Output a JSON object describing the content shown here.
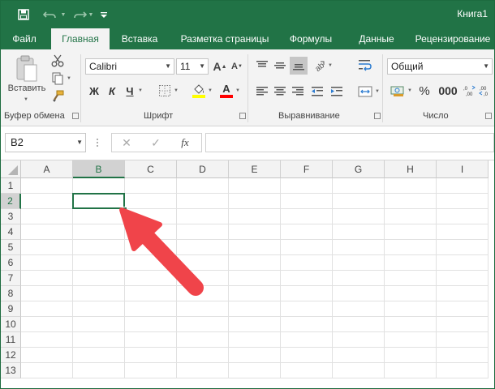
{
  "window": {
    "title": "Книга1"
  },
  "qat": {
    "save_icon": "save-icon",
    "undo_icon": "undo-icon",
    "redo_icon": "redo-icon",
    "customize_icon": "customize-qat-icon"
  },
  "tabs": [
    {
      "label": "Файл",
      "active": false
    },
    {
      "label": "Главная",
      "active": true
    },
    {
      "label": "Вставка",
      "active": false
    },
    {
      "label": "Разметка страницы",
      "active": false
    },
    {
      "label": "Формулы",
      "active": false
    },
    {
      "label": "Данные",
      "active": false
    },
    {
      "label": "Рецензирование",
      "active": false
    }
  ],
  "ribbon": {
    "clipboard": {
      "label": "Буфер обмена",
      "paste_label": "Вставить"
    },
    "font": {
      "label": "Шрифт",
      "font_name": "Calibri",
      "font_size": "11",
      "bold": "Ж",
      "italic": "К",
      "underline": "Ч",
      "fill_color": "#ffff00",
      "font_color": "#ff0000"
    },
    "alignment": {
      "label": "Выравнивание"
    },
    "number": {
      "label": "Число",
      "format": "Общий"
    }
  },
  "formula_bar": {
    "name_box": "B2",
    "cancel": "✕",
    "enter": "✓",
    "fx": "fx",
    "formula": ""
  },
  "sheet": {
    "columns": [
      "A",
      "B",
      "C",
      "D",
      "E",
      "F",
      "G",
      "H",
      "I"
    ],
    "rows": [
      "1",
      "2",
      "3",
      "4",
      "5",
      "6",
      "7",
      "8",
      "9",
      "10",
      "11",
      "12",
      "13"
    ],
    "selected_cell": "B2",
    "selected_column": "B",
    "selected_row": "2",
    "accent": "#217346"
  },
  "annotation": {
    "arrow_color": "#f0444a"
  }
}
